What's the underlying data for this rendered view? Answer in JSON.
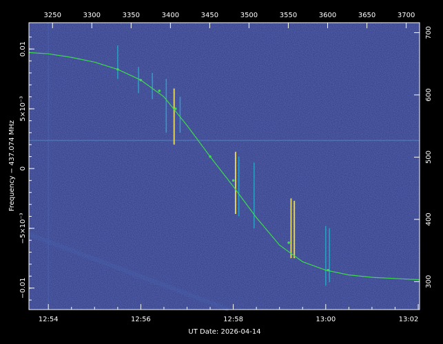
{
  "chart_data": {
    "type": "line",
    "xlabel": "UT Date: 2026-04-14",
    "ylabel": "Frequency − 437.074 MHz",
    "bottom_axis": {
      "ticks": [
        {
          "t": 0.0,
          "label": "12:54"
        },
        {
          "t": 2.0,
          "label": "12:56"
        },
        {
          "t": 4.0,
          "label": "12:58"
        },
        {
          "t": 6.0,
          "label": "13:00"
        },
        {
          "t": 8.0,
          "label": "13:02"
        }
      ],
      "xlim": [
        -0.42,
        8.03
      ]
    },
    "top_axis": {
      "ticks": [
        3250,
        3300,
        3350,
        3400,
        3450,
        3500,
        3550,
        3600,
        3650,
        3700
      ]
    },
    "left_axis": {
      "ticks": [
        {
          "v": 0.01,
          "label": "0.01"
        },
        {
          "v": 0.005,
          "label": "5×10⁻³"
        },
        {
          "v": 0.0,
          "label": "0"
        },
        {
          "v": -0.005,
          "label": "−5×10⁻³"
        },
        {
          "v": -0.01,
          "label": "−0.01"
        }
      ],
      "ylim": [
        -0.0118,
        0.0122
      ]
    },
    "right_axis": {
      "ticks": [
        300,
        400,
        500,
        600,
        700
      ]
    },
    "doppler_curve": {
      "x": [
        -0.42,
        0.0,
        0.5,
        1.0,
        1.5,
        2.0,
        2.5,
        3.0,
        3.5,
        4.0,
        4.5,
        5.0,
        5.5,
        6.0,
        6.5,
        7.0,
        7.5,
        8.03
      ],
      "y": [
        0.0097,
        0.0096,
        0.0093,
        0.0089,
        0.0083,
        0.0074,
        0.006,
        0.0036,
        0.001,
        -0.0015,
        -0.0041,
        -0.0064,
        -0.0078,
        -0.0085,
        -0.0089,
        -0.0091,
        -0.0092,
        -0.0093
      ]
    },
    "curve_markers": {
      "x": [
        1.5,
        2.0,
        2.4,
        2.75,
        3.5,
        4.0,
        5.2,
        6.05
      ],
      "y": [
        0.0083,
        0.0074,
        0.0065,
        0.005,
        0.001,
        -0.001,
        -0.0062,
        -0.0085
      ]
    },
    "signal_bursts": [
      {
        "x": 1.5,
        "y0": 0.0103,
        "y1": 0.0075,
        "level": "low"
      },
      {
        "x": 1.95,
        "y0": 0.0085,
        "y1": 0.0063,
        "level": "low"
      },
      {
        "x": 2.25,
        "y0": 0.008,
        "y1": 0.0058,
        "level": "low"
      },
      {
        "x": 2.55,
        "y0": 0.0075,
        "y1": 0.003,
        "level": "low"
      },
      {
        "x": 2.72,
        "y0": 0.0067,
        "y1": 0.002,
        "level": "high"
      },
      {
        "x": 2.85,
        "y0": 0.006,
        "y1": 0.003,
        "level": "low"
      },
      {
        "x": 4.05,
        "y0": 0.0014,
        "y1": -0.0038,
        "level": "high"
      },
      {
        "x": 4.12,
        "y0": 0.001,
        "y1": -0.004,
        "level": "low"
      },
      {
        "x": 4.45,
        "y0": 0.0005,
        "y1": -0.005,
        "level": "low"
      },
      {
        "x": 5.25,
        "y0": -0.0025,
        "y1": -0.0075,
        "level": "high"
      },
      {
        "x": 5.32,
        "y0": -0.0027,
        "y1": -0.0075,
        "level": "high"
      },
      {
        "x": 6.0,
        "y0": -0.0048,
        "y1": -0.0098,
        "level": "low"
      },
      {
        "x": 6.08,
        "y0": -0.005,
        "y1": -0.0095,
        "level": "low"
      }
    ],
    "grid": false,
    "colors": {
      "background": "#2e3a86",
      "curve": "#3ddc4a",
      "burst_low": "#2aa9c9",
      "burst_high": "#f5e04a",
      "axes": "#ffffff"
    }
  }
}
